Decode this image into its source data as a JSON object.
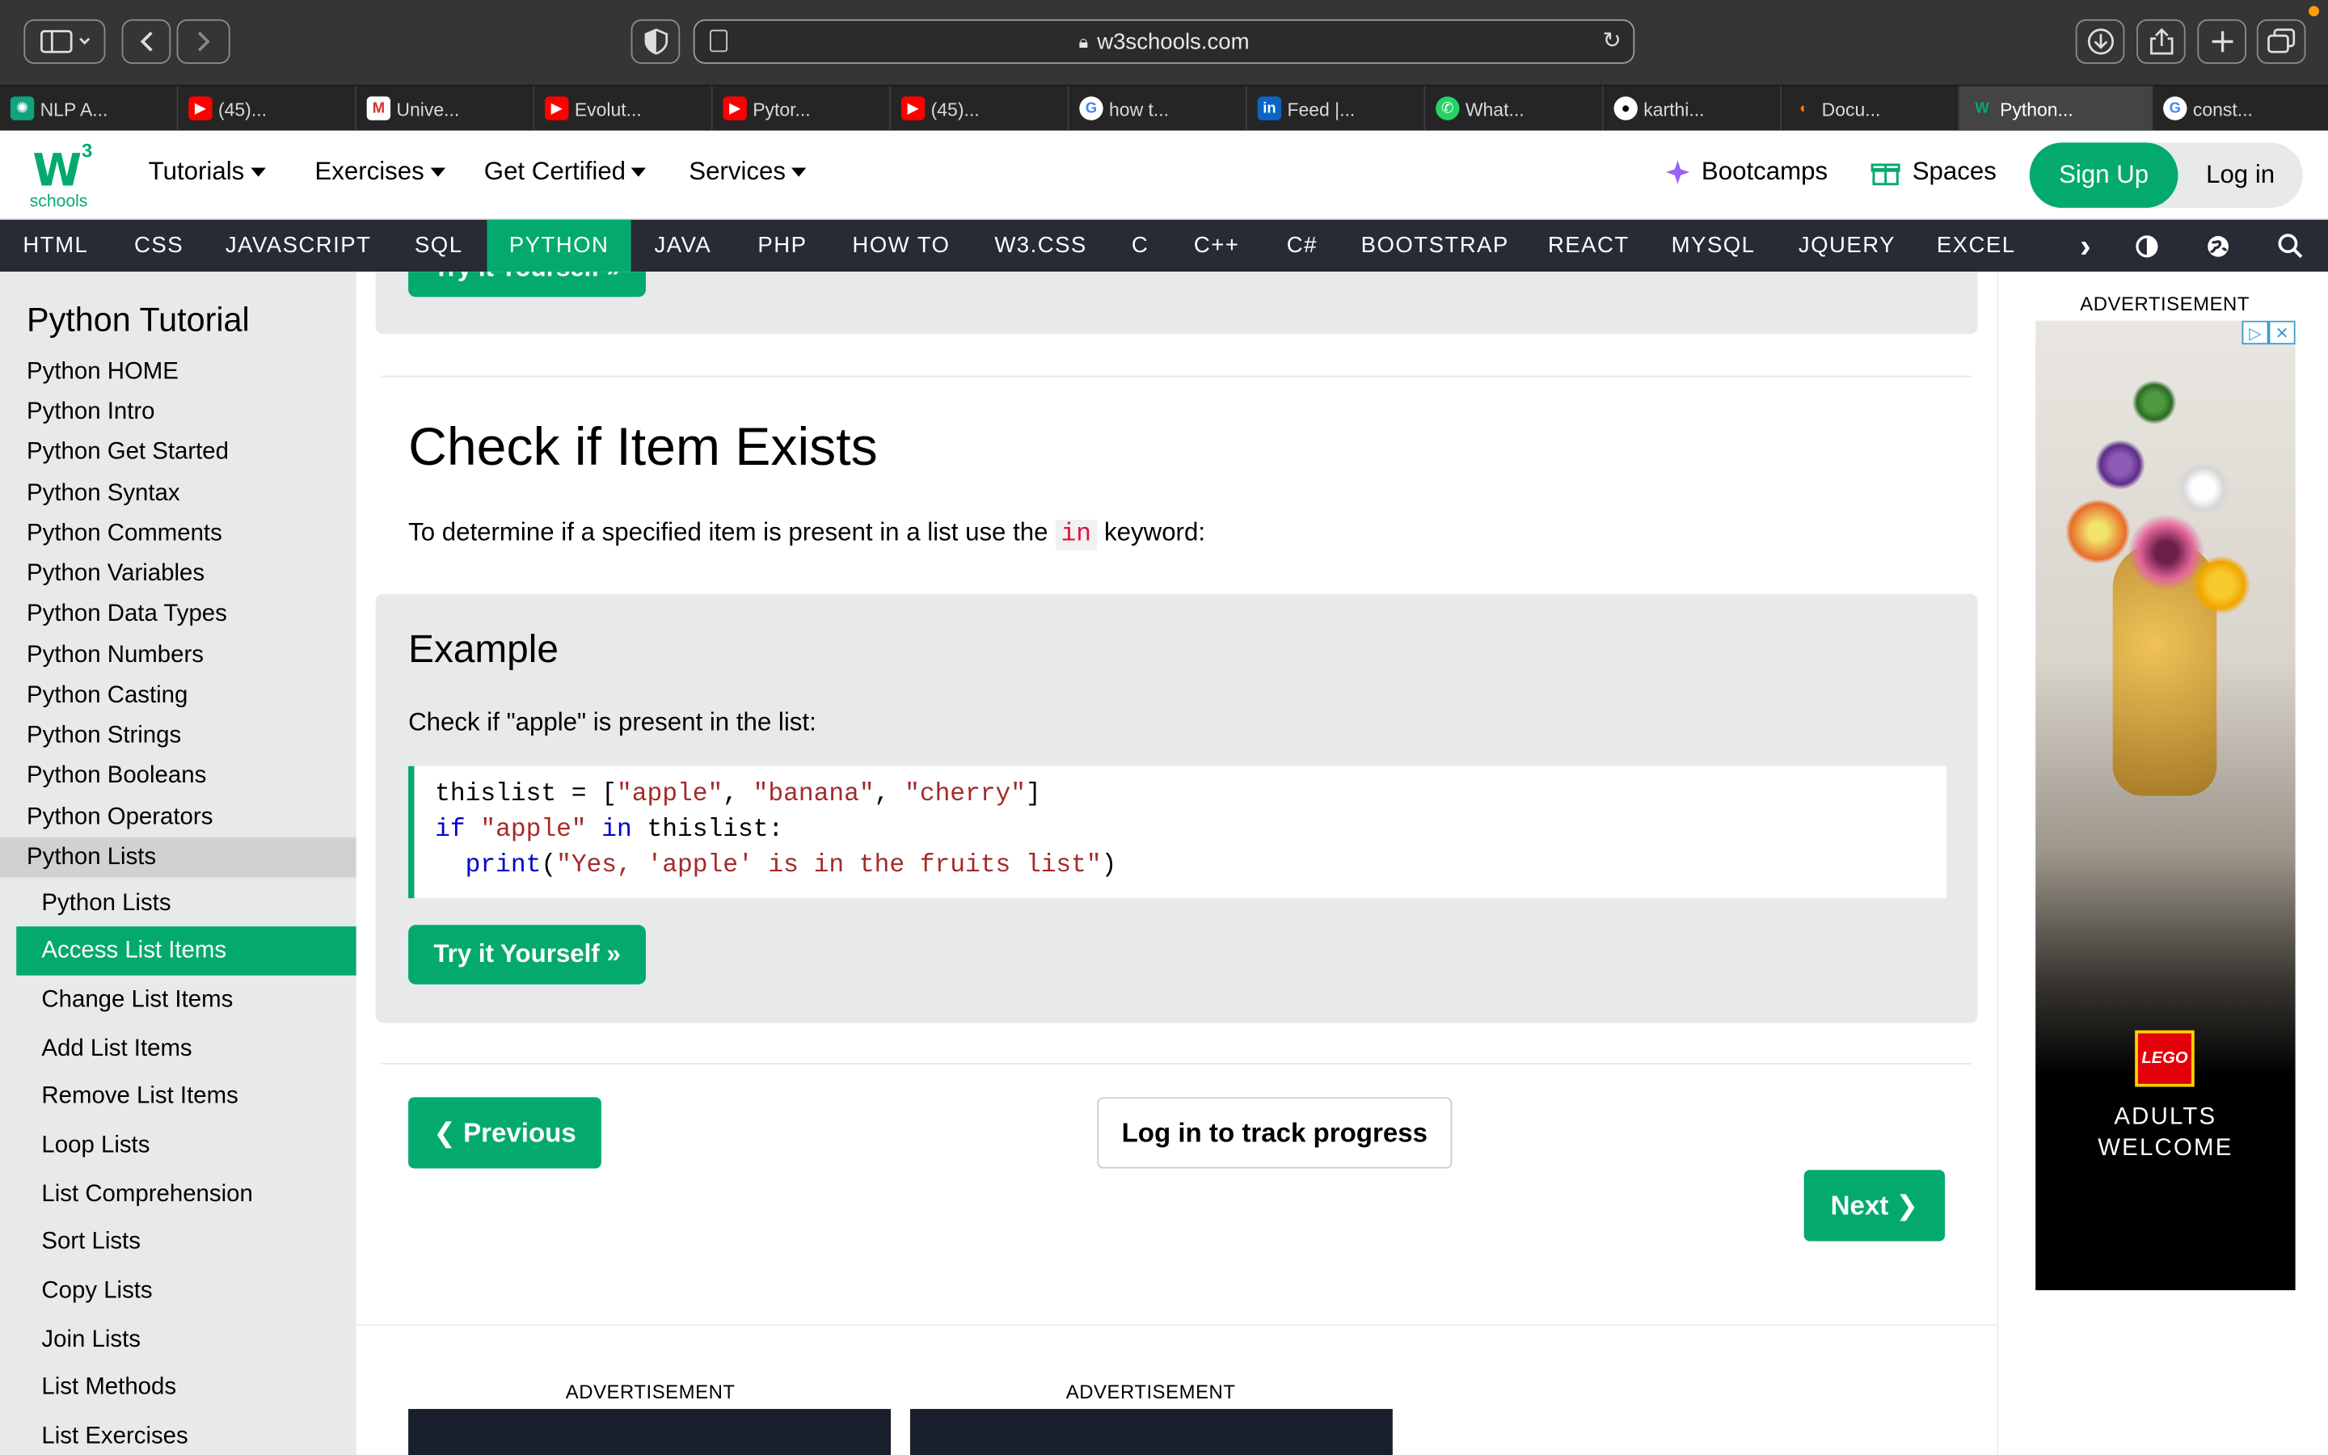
{
  "browser": {
    "url": "w3schools.com",
    "tabs": [
      {
        "label": "NLP A...",
        "icon": "openai-icon"
      },
      {
        "label": "(45)...",
        "icon": "youtube-icon"
      },
      {
        "label": "Unive...",
        "icon": "gmail-icon"
      },
      {
        "label": "Evolut...",
        "icon": "youtube-icon"
      },
      {
        "label": "Pytor...",
        "icon": "youtube-icon"
      },
      {
        "label": "(45)...",
        "icon": "youtube-icon"
      },
      {
        "label": "how t...",
        "icon": "google-icon"
      },
      {
        "label": "Feed |...",
        "icon": "linkedin-icon"
      },
      {
        "label": "What...",
        "icon": "whatsapp-icon"
      },
      {
        "label": "karthi...",
        "icon": "github-icon"
      },
      {
        "label": "Docu...",
        "icon": "docu-icon"
      },
      {
        "label": "Python...",
        "icon": "w3schools-icon"
      },
      {
        "label": "const...",
        "icon": "google-icon"
      }
    ]
  },
  "topnav": {
    "logo_text": "schools",
    "logo_sup": "3",
    "menus": [
      "Tutorials",
      "Exercises",
      "Get Certified",
      "Services"
    ],
    "bootcamps": "Bootcamps",
    "spaces": "Spaces",
    "signup": "Sign Up",
    "login": "Log in"
  },
  "darknav": {
    "items": [
      "HTML",
      "CSS",
      "JAVASCRIPT",
      "SQL",
      "PYTHON",
      "JAVA",
      "PHP",
      "HOW TO",
      "W3.CSS",
      "C",
      "C++",
      "C#",
      "BOOTSTRAP",
      "REACT",
      "MYSQL",
      "JQUERY",
      "EXCEL"
    ],
    "active": "PYTHON",
    "more": "›"
  },
  "sidebar": {
    "title": "Python Tutorial",
    "items": [
      "Python HOME",
      "Python Intro",
      "Python Get Started",
      "Python Syntax",
      "Python Comments",
      "Python Variables",
      "Python Data Types",
      "Python Numbers",
      "Python Casting",
      "Python Strings",
      "Python Booleans",
      "Python Operators",
      "Python Lists"
    ],
    "sub_items": [
      "Python Lists",
      "Access List Items",
      "Change List Items",
      "Add List Items",
      "Remove List Items",
      "Loop Lists",
      "List Comprehension",
      "Sort Lists",
      "Copy Lists",
      "Join Lists",
      "List Methods",
      "List Exercises"
    ],
    "active_sub": "Access List Items"
  },
  "main": {
    "top_try_button": "Try it Yourself »",
    "heading": "Check if Item Exists",
    "intro_before": "To determine if a specified item is present in a list use the ",
    "intro_code": "in",
    "intro_after": " keyword:",
    "example_title": "Example",
    "example_desc": "Check if \"apple\" is present in the list:",
    "code": {
      "line1_a": "thislist = [",
      "line1_s1": "\"apple\"",
      "line1_c1": ", ",
      "line1_s2": "\"banana\"",
      "line1_c2": ", ",
      "line1_s3": "\"cherry\"",
      "line1_end": "]",
      "line2_kw1": "if",
      "line2_s": " \"apple\"",
      "line2_kw2": " in",
      "line2_end": " thislist:",
      "line3_indent": "  ",
      "line3_kw": "print",
      "line3_a": "(",
      "line3_s": "\"Yes, 'apple' is in the fruits list\"",
      "line3_end": ")"
    },
    "try_button": "Try it Yourself »",
    "previous": "❮ Previous",
    "track": "Log in to track progress",
    "next": "Next ❯",
    "ad_label_1": "ADVERTISEMENT",
    "ad_label_2": "ADVERTISEMENT"
  },
  "right_ad": {
    "label": "ADVERTISEMENT",
    "brand": "LEGO",
    "line1": "ADULTS",
    "line2": "WELCOME"
  }
}
